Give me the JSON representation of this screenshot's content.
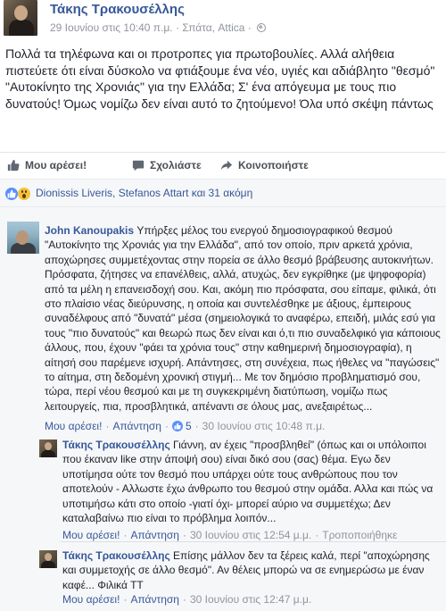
{
  "post": {
    "author": "Τάκης Τρακουσέλλης",
    "meta_date": "29 Ιουνίου στις 10:40 π.μ.",
    "meta_sep": "·",
    "meta_location": "Σπάτα, Attica",
    "meta_sep2": "·",
    "text": "Πολλά τα τηλέφωνα και οι προτροπες για πρωτοβουλίες. Αλλά αλήθεια πιστεύετε ότι είναι δύσκολο να φτιάξουμε ένα νέο, υγιές και αδιάβλητο \"θεσμό\" \"Αυτοκίνητο της Χρονιάς\" για την Ελλάδα; Σ' ένα απόγευμα με τους πιο δυνατούς! Όμως νομίζω δεν είναι αυτό το ζητούμενο! Όλα υπό σκέψη πάντως"
  },
  "actions": {
    "like": "Μου αρέσει!",
    "comment": "Σχολιάστε",
    "share": "Κοινοποιήστε"
  },
  "reactions": {
    "text": "Dionissis Liveris, Stefanos Attart και 31 ακόμη"
  },
  "comments": [
    {
      "name": "John Kanoupakis",
      "text": "Υπήρξες μέλος του ενεργού δημοσιογραφικού θεσμού \"Αυτοκίνητο της Χρονιάς για την Ελλάδα\", από τον οποίο, πριν αρκετά χρόνια, αποχώρησες συμμετέχοντας στην πορεία σε άλλο θεσμό βράβευσης αυτοκινήτων. Πρόσφατα, ζήτησες να επανέλθεις, αλλά, ατυχώς, δεν εγκρίθηκε (με ψηφοφορία) από τα μέλη η επανεισδοχή σου. Και, ακόμη πιο πρόσφατα, σου είπαμε, φιλικά, ότι στο πλαίσιο νέας διεύρυνσης, η οποία και συντελέσθηκε με άξιους, έμπειρους συναδέλφους από \"δυνατά\" μέσα (σημειολογικά το αναφέρω, επειδή, μιλάς εσύ για τους \"πιο δυνατούς\" και θεωρώ πως δεν είναι και ό,τι πιο συναδελφικό για κάποιους άλλους, που, έχουν \"φάει τα χρόνια τους\" στην καθημερινή δημοσιογραφία), η αίτησή σου παρέμενε ισχυρή. Απάντησες, στη συνέχεια, πως ήθελες να \"παγώσεις\" το αίτημα, στη δεδομένη χρονική στιγμή... Με τον δημόσιο προβληματισμό σου, τώρα, περί νέου θεσμού και με τη συγκεκριμένη διατύπωση, νομίζω πως λειτουργείς, πια, προσβλητικά, απέναντι σε όλους μας, ανεξαιρέτως...",
      "like": "Μου αρέσει!",
      "reply": "Απάντηση",
      "like_count": "5",
      "time": "30 Ιουνίου στις 10:48 π.μ."
    },
    {
      "name": "Τάκης Τρακουσέλλης",
      "text": "Γιάννη, αν έχεις \"προσβληθεί\" (όπως και οι υπόλοιποι που έκαναν like στην άποψή σου) είναι δικό σου (σας) θέμα. Εγω δεν υποτίμησα ούτε τον θεσμό που υπάρχει ούτε τους ανθρώπους που τον αποτελούν - Αλλωστε έχω άνθρωπο του θεσμού στην ομάδα. Αλλα και πώς να υποτιμήσω κάτι στο οποίο -γιατί όχι- μπορεί αύριο να συμμετέχω; Δεν καταλαβαίνω πιο είναι το πρόβλημα λοιπόν...",
      "like": "Μου αρέσει!",
      "reply": "Απάντηση",
      "time": "30 Ιουνίου στις 12:54 μ.μ.",
      "extra": "Τροποποιήθηκε"
    },
    {
      "name": "Τάκης Τρακουσέλλης",
      "text": "Επίσης μάλλον δεν τα ξέρεις καλά, περί \"αποχώρησης και συμμετοχής σε άλλο θεσμό\". Αν θέλεις μπορώ να σε ενημερώσω με έναν καφέ... Φιλικά ΤΤ",
      "like": "Μου αρέσει!",
      "reply": "Απάντηση",
      "time": "30 Ιουνίου στις 12:47 μ.μ."
    }
  ],
  "colors": {
    "link": "#365899",
    "meta": "#90949c",
    "like_blue": "#5890ff",
    "background_gray": "#f6f7f9"
  },
  "icons": [
    "thumbs-up-icon",
    "comment-bubble-icon",
    "share-arrow-icon",
    "globe-icon",
    "like-reaction-icon",
    "wow-reaction-icon"
  ]
}
